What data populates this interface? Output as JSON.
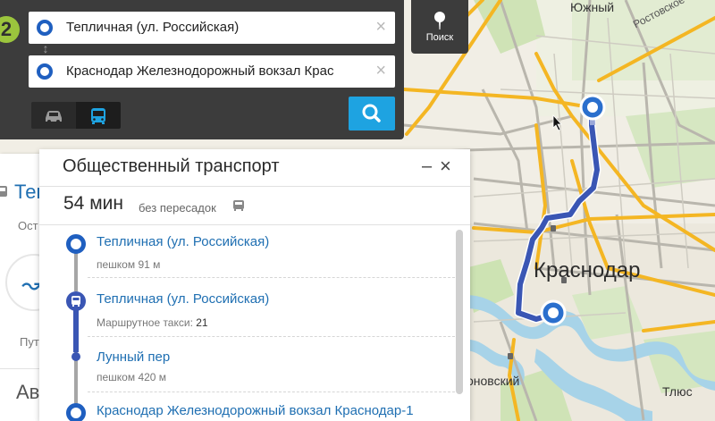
{
  "map": {
    "city_label": "Краснодар",
    "district_label": "Южный",
    "street_label": "Ростовское",
    "bottom_label": "оновский",
    "right_label": "Тлюс"
  },
  "search": {
    "badge": "2",
    "from_value": "Тепличная (ул. Российская)",
    "to_value": "Краснодар Железнодорожный вокзал Крас",
    "clear_glyph": "×",
    "modes": [
      {
        "name": "car",
        "icon": "car-icon",
        "selected": false
      },
      {
        "name": "bus",
        "icon": "bus-icon",
        "selected": true
      }
    ],
    "accent_color": "#1ea3e1"
  },
  "poisk": {
    "label": "Поиск"
  },
  "side_panel": {
    "title": "Тепл",
    "subtitle": "Ост",
    "caption": "Пут",
    "heading": "Ав"
  },
  "transit": {
    "title": "Общественный транспорт",
    "minimize_glyph": "–",
    "close_glyph": "×",
    "duration": "54 мин",
    "transfers": "без пересадок",
    "steps": [
      {
        "title": "Тепличная (ул. Российская)",
        "sub": "пешком 91 м"
      },
      {
        "title": "Тепличная (ул. Российская)",
        "sub_prefix": "Маршрутное такси:",
        "sub_value": "21"
      },
      {
        "title": "Лунный пер",
        "sub": "пешком 420 м"
      },
      {
        "title": "Краснодар Железнодорожный вокзал Краснодар-1"
      }
    ]
  }
}
